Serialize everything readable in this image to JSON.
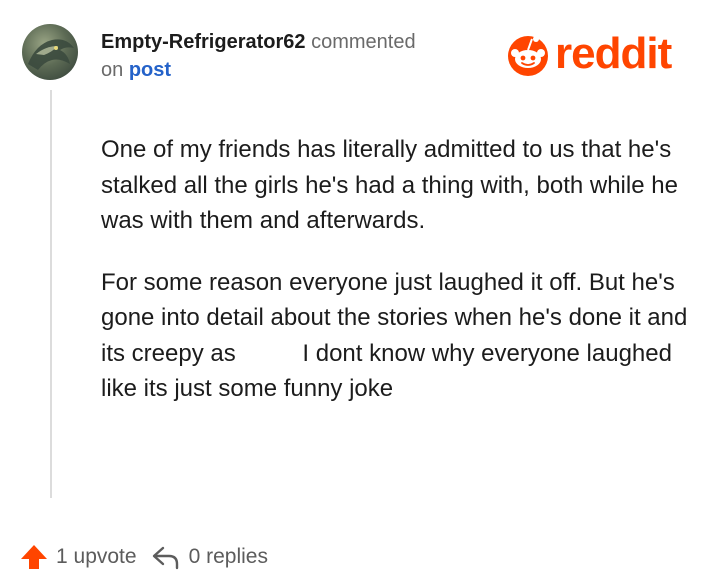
{
  "comment": {
    "author": "Empty-Refrigerator62",
    "action_text": "commented",
    "on_text": "on",
    "post_link": "post",
    "paragraphs": [
      "One of my friends has literally admitted to us that he's stalked all the girls he's had a thing with, both while he was with them and afterwards.",
      "For some reason everyone just laughed it off. But he's gone into detail about the stories when he's done it and its creepy as    I dont know why everyone laughed like its just some funny joke"
    ]
  },
  "brand": {
    "wordmark": "reddit",
    "color": "#ff4500"
  },
  "footer": {
    "upvote_label": "1 upvote",
    "replies_label": "0 replies",
    "upvote_icon": "upvote-arrow-icon",
    "reply_icon": "reply-arrow-icon"
  },
  "colors": {
    "link": "#2462c9",
    "upvote": "#ff4500",
    "muted": "#6a6a6a"
  }
}
